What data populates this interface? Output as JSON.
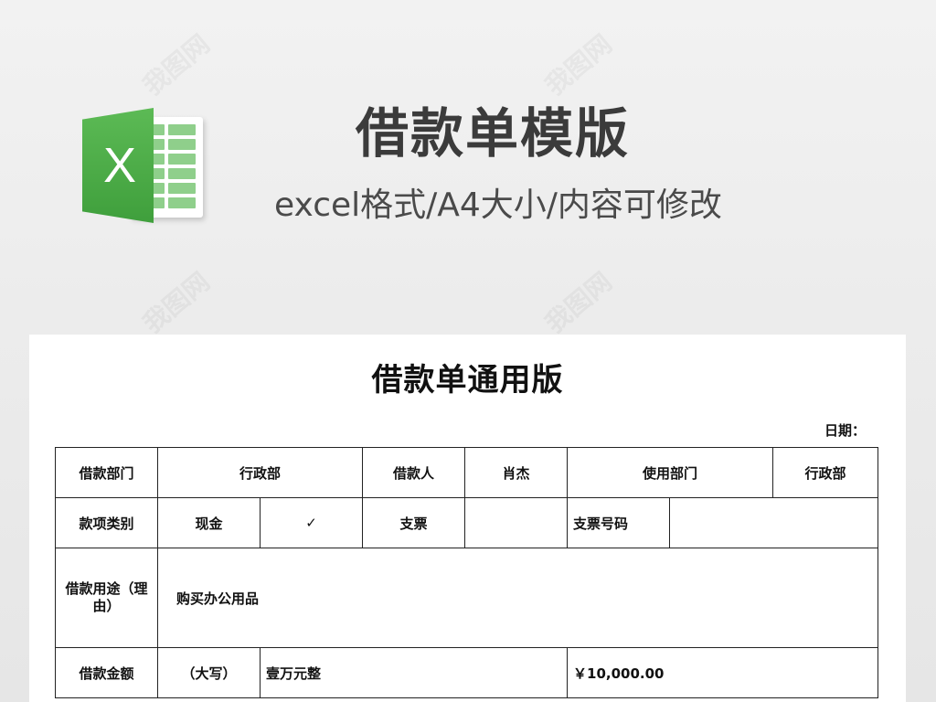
{
  "header": {
    "title": "借款单模版",
    "subtitle": "excel格式/A4大小/内容可修改",
    "logo_letter": "X"
  },
  "document": {
    "title": "借款单通用版",
    "date_label": "日期："
  },
  "table": {
    "row1": {
      "dept_label": "借款部门",
      "dept_value": "行政部",
      "borrower_label": "借款人",
      "borrower_value": "肖杰",
      "use_dept_label": "使用部门",
      "use_dept_value": "行政部"
    },
    "row2": {
      "category_label": "款项类别",
      "cash_label": "现金",
      "cash_mark": "✓",
      "cheque_label": "支票",
      "cheque_value": "",
      "cheque_no_label": "支票号码",
      "cheque_no_value": ""
    },
    "row3": {
      "purpose_label": "借款用途（理由）",
      "purpose_value": "购买办公用品"
    },
    "row4": {
      "amount_label": "借款金额",
      "uppercase_label": "（大写）",
      "uppercase_value": "壹万元整",
      "numeric_value": "￥10,000.00"
    }
  },
  "watermark": {
    "text": "我图网"
  },
  "colors": {
    "excel_green": "#4caf50",
    "title_gray": "#3b3b3b"
  }
}
